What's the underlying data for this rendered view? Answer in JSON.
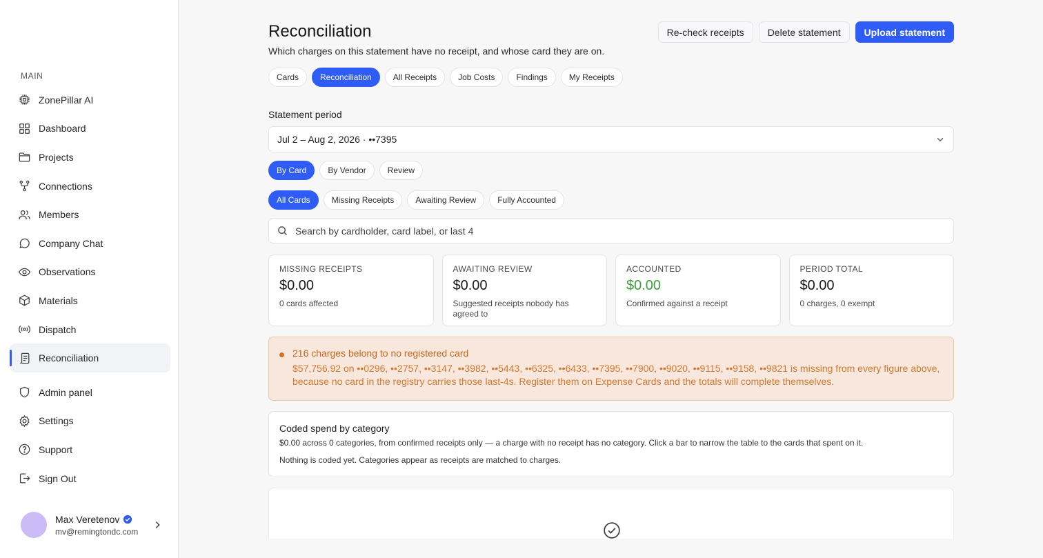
{
  "sidebar": {
    "section_label": "MAIN",
    "items": [
      {
        "label": "ZonePillar AI",
        "icon": "cpu-chip-icon"
      },
      {
        "label": "Dashboard",
        "icon": "grid-icon"
      },
      {
        "label": "Projects",
        "icon": "folder-icon"
      },
      {
        "label": "Connections",
        "icon": "git-fork-icon"
      },
      {
        "label": "Members",
        "icon": "users-icon"
      },
      {
        "label": "Company Chat",
        "icon": "chat-bubble-icon"
      },
      {
        "label": "Observations",
        "icon": "eye-icon"
      },
      {
        "label": "Materials",
        "icon": "box-icon"
      },
      {
        "label": "Dispatch",
        "icon": "radio-broadcast-icon"
      },
      {
        "label": "Reconciliation",
        "icon": "receipt-icon",
        "active": true
      }
    ],
    "secondary_items": [
      {
        "label": "Admin panel",
        "icon": "shield-icon"
      },
      {
        "label": "Settings",
        "icon": "gear-icon"
      },
      {
        "label": "Support",
        "icon": "help-circle-icon"
      },
      {
        "label": "Sign Out",
        "icon": "sign-out-icon"
      }
    ],
    "user": {
      "name": "Max Veretenov",
      "email": "mv@remingtondc.com",
      "avatar_color": "#cbbcf8"
    }
  },
  "header": {
    "title": "Reconciliation",
    "subtitle": "Which charges on this statement have no receipt, and whose card they are on.",
    "actions": {
      "recheck": "Re-check receipts",
      "delete": "Delete statement",
      "upload": "Upload statement"
    }
  },
  "tabs": [
    "Cards",
    "Reconciliation",
    "All Receipts",
    "Job Costs",
    "Findings",
    "My Receipts"
  ],
  "active_tab": "Reconciliation",
  "statement": {
    "label": "Statement period",
    "selected": "Jul 2 – Aug 2, 2026 · ••7395"
  },
  "group_tabs": [
    "By Card",
    "By Vendor",
    "Review"
  ],
  "active_group_tab": "By Card",
  "filter_tabs": [
    "All Cards",
    "Missing Receipts",
    "Awaiting Review",
    "Fully Accounted"
  ],
  "active_filter_tab": "All Cards",
  "search": {
    "placeholder": "Search by cardholder, card label, or last 4"
  },
  "summary": [
    {
      "label": "MISSING RECEIPTS",
      "value": "$0.00",
      "note": "0 cards affected"
    },
    {
      "label": "AWAITING REVIEW",
      "value": "$0.00",
      "note": "Suggested receipts nobody has agreed to"
    },
    {
      "label": "ACCOUNTED",
      "value": "$0.00",
      "note": "Confirmed against a receipt",
      "value_color": "#3c9f3c"
    },
    {
      "label": "PERIOD TOTAL",
      "value": "$0.00",
      "note": "0 charges, 0 exempt"
    }
  ],
  "alert": {
    "title": "216 charges belong to no registered card",
    "body": "$57,756.92 on ••0296, ••2757, ••3147, ••3982, ••5443, ••6325, ••6433, ••7395, ••7900, ••9020, ••9115, ••9158, ••9821 is missing from every figure above, because no card in the registry carries those last-4s. Register them on Expense Cards and the totals will complete themselves."
  },
  "category_panel": {
    "title": "Coded spend by category",
    "description": "$0.00 across 0 categories, from confirmed receipts only — a charge with no receipt has no category. Click a bar to narrow the table to the cards that spent on it.",
    "empty": "Nothing is coded yet. Categories appear as receipts are matched to charges."
  },
  "colors": {
    "accent": "#2f5cf5",
    "success": "#3c9f3c",
    "warning_text": "#c8671c",
    "warning_bg": "#f7e7dc"
  }
}
